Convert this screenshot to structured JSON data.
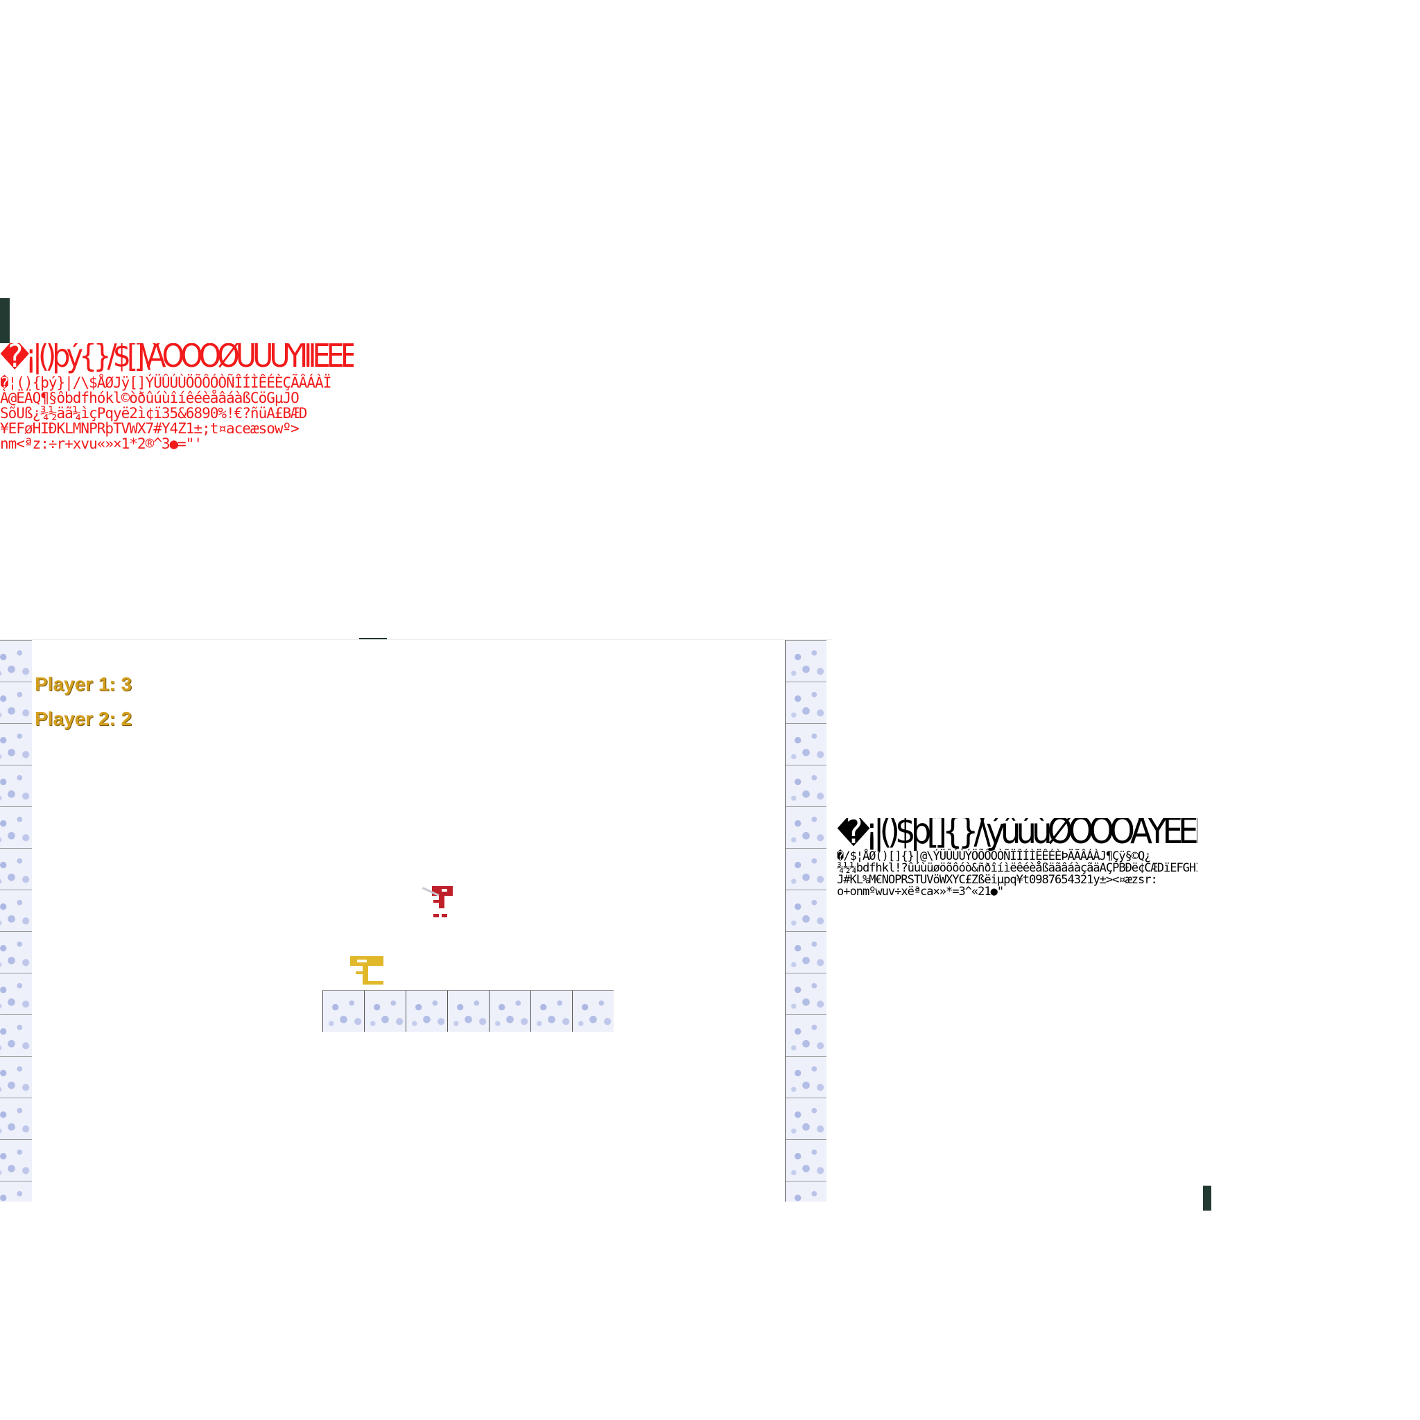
{
  "atlas_red": {
    "large_glyphs": "�¡|()þý{}/$[]\\ÅÒÓÔØÙÚÛÝÍÎÌÊÉÈÀÂÁJÝÜÖÕÑÇÃ@ÏË§Ä¶Qå©ìbdfhkl!?ûúùêéèâáôìàßíîðòó¿ñ¾¼õ%&ã½gµpqÿçABCäDE¢ëFGÐH#IJïK€øLïMN£OPRS¥öTüUVWXYZÆ;þ1098765432t±¤><æºsrvu:onmxw÷zªace+»«×®2*1^3●¨\"'",
    "small_glyphs": "�¦(){þý}|/\\$ÅØJÿ[]ÝÜÛÚÙÖÕÔÓÒÑÎÍÌÊÉÈÇÃÂÁÀÏ\nÀ@ËÄQ¶§ôbdfhókl©òðûúùîíêéèåâáàßCöGµJO\nSõUß¿¾½äã¼ìçPqyë2ì¢ï35&6890%!€?ñüA£BÆD\n¥EFøHIÐKLMNPRþTVWX7#Y4Z1±;t¤aceæsowº>\nnm<ªz:÷r+xvu«»×1*2®^3●=\"'"
  },
  "atlas_black": {
    "large_glyphs": "�¡|()$þ[]{}/\\ýûúùØÔÓÒÅÝÉÈÎÍÊÌÀÂÁJÝÇÕÏÜÖÑÃ@ÄË¶§Qåbd?ûiúùõ©ôóòðêéèâáàßfhl!¿k¼¾½&ñîíìãüCGO¢ï'Sëä36890ö€%çJ£Ugpl·q25ïABÆDEFHØKLþM;N#PRTVWX¥µY7ZÐ4y1t±¤æ><÷saceoumr:ºªnv+zxw×«»31®2*^●=\"'",
    "small_glyphs": "�/$¦ÅØ()[]{}|@\\ÝÜÛÚÙÝÖÕÔÓÒÑÏÎÍÌËÊÉÈÞÄÃÂÁÀJ¶Çÿ§©Q¿\n¾½¼bdfhkl!?ûúùüøöõôóò&ñðîíìëêéèåßäãâáàçãäAÇPBÐë¢CÆDïEFGHI;\nJ#KL%M€NOPRSTUVöWXYC£Zßëiµpq¥t0987654321y±><¤æzsr:\no+onmºwuv÷xëªca×»*=3^«21●\""
  },
  "hud": {
    "player1": "Player 1: 3",
    "player2": "Player 2: 2"
  },
  "sprites": {
    "player_red": "red-knight",
    "player_yellow": "yellow-knight"
  },
  "colors": {
    "red_player": "#c0202a",
    "yellow_player": "#e0b82a",
    "score_text": "#d4a020",
    "atlas_red": "#f21a1a",
    "atlas_black": "#000000",
    "marker": "#233a32"
  }
}
